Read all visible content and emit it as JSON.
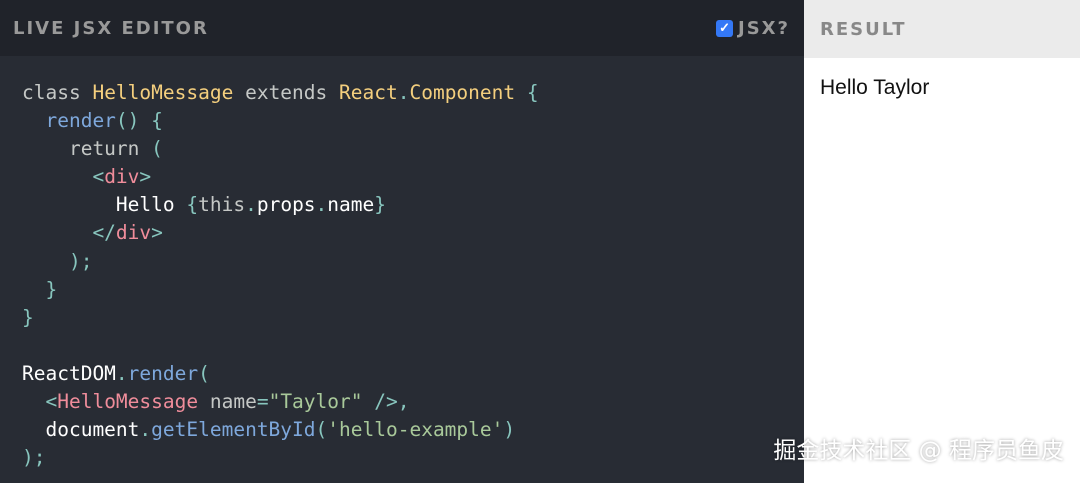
{
  "editor": {
    "title": "LIVE JSX EDITOR",
    "jsx_label": "JSX?",
    "jsx_checked": true,
    "lines": [
      [
        {
          "t": "class ",
          "c": "kw"
        },
        {
          "t": "HelloMessage",
          "c": "cls"
        },
        {
          "t": " extends ",
          "c": "kw"
        },
        {
          "t": "React",
          "c": "cls"
        },
        {
          "t": ".",
          "c": "pun"
        },
        {
          "t": "Component",
          "c": "cls"
        },
        {
          "t": " {",
          "c": "pun"
        }
      ],
      [
        {
          "t": "  render",
          "c": "fn"
        },
        {
          "t": "() {",
          "c": "pun"
        }
      ],
      [
        {
          "t": "    return ",
          "c": "kw"
        },
        {
          "t": "(",
          "c": "pun"
        }
      ],
      [
        {
          "t": "      <",
          "c": "pun"
        },
        {
          "t": "div",
          "c": "tag"
        },
        {
          "t": ">",
          "c": "pun"
        }
      ],
      [
        {
          "t": "        Hello ",
          "c": "txt"
        },
        {
          "t": "{",
          "c": "pun"
        },
        {
          "t": "this",
          "c": "kw"
        },
        {
          "t": ".",
          "c": "pun"
        },
        {
          "t": "props",
          "c": "txt"
        },
        {
          "t": ".",
          "c": "pun"
        },
        {
          "t": "name",
          "c": "txt"
        },
        {
          "t": "}",
          "c": "pun"
        }
      ],
      [
        {
          "t": "      </",
          "c": "pun"
        },
        {
          "t": "div",
          "c": "tag"
        },
        {
          "t": ">",
          "c": "pun"
        }
      ],
      [
        {
          "t": "    );",
          "c": "pun"
        }
      ],
      [
        {
          "t": "  }",
          "c": "pun"
        }
      ],
      [
        {
          "t": "}",
          "c": "pun"
        }
      ],
      [
        {
          "t": " ",
          "c": "txt"
        }
      ],
      [
        {
          "t": "ReactDOM",
          "c": "txt"
        },
        {
          "t": ".",
          "c": "pun"
        },
        {
          "t": "render",
          "c": "fn"
        },
        {
          "t": "(",
          "c": "pun"
        }
      ],
      [
        {
          "t": "  <",
          "c": "pun"
        },
        {
          "t": "HelloMessage",
          "c": "tag"
        },
        {
          "t": " name",
          "c": "attr"
        },
        {
          "t": "=",
          "c": "pun"
        },
        {
          "t": "\"Taylor\"",
          "c": "str"
        },
        {
          "t": " />,",
          "c": "pun"
        }
      ],
      [
        {
          "t": "  document",
          "c": "txt"
        },
        {
          "t": ".",
          "c": "pun"
        },
        {
          "t": "getElementById",
          "c": "fn"
        },
        {
          "t": "(",
          "c": "pun"
        },
        {
          "t": "'hello-example'",
          "c": "str"
        },
        {
          "t": ")",
          "c": "pun"
        }
      ],
      [
        {
          "t": ");",
          "c": "pun"
        }
      ]
    ]
  },
  "result": {
    "title": "RESULT",
    "output": "Hello Taylor"
  },
  "watermark": "掘金技术社区 @ 程序员鱼皮"
}
